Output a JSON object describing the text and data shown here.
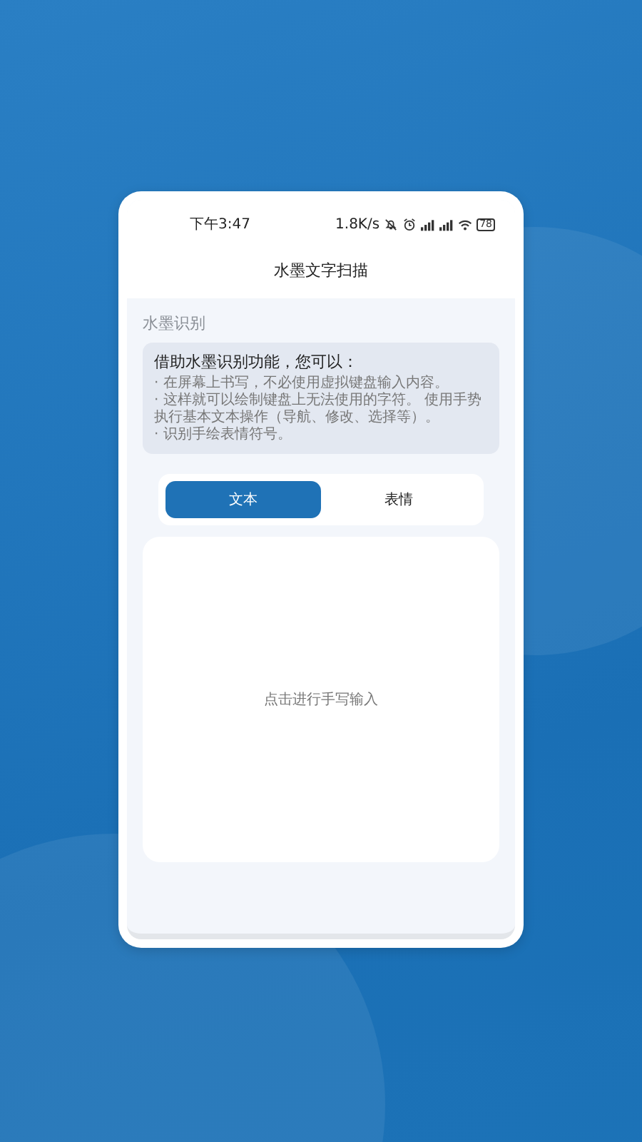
{
  "status_bar": {
    "time": "下午3:47",
    "speed": "1.8K/s",
    "battery": "78"
  },
  "title": "水墨文字扫描",
  "section_label": "水墨识别",
  "info": {
    "heading": "借助水墨识别功能，您可以：",
    "items": [
      "· 在屏幕上书写，不必使用虚拟键盘输入内容。",
      "· 这样就可以绘制键盘上无法使用的字符。 使用手势执行基本文本操作（导航、修改、选择等）。",
      "· 识别手绘表情符号。"
    ]
  },
  "tabs": [
    {
      "label": "文本",
      "selected": true
    },
    {
      "label": "表情",
      "selected": false
    }
  ],
  "canvas": {
    "hint": "点击进行手写输入"
  }
}
